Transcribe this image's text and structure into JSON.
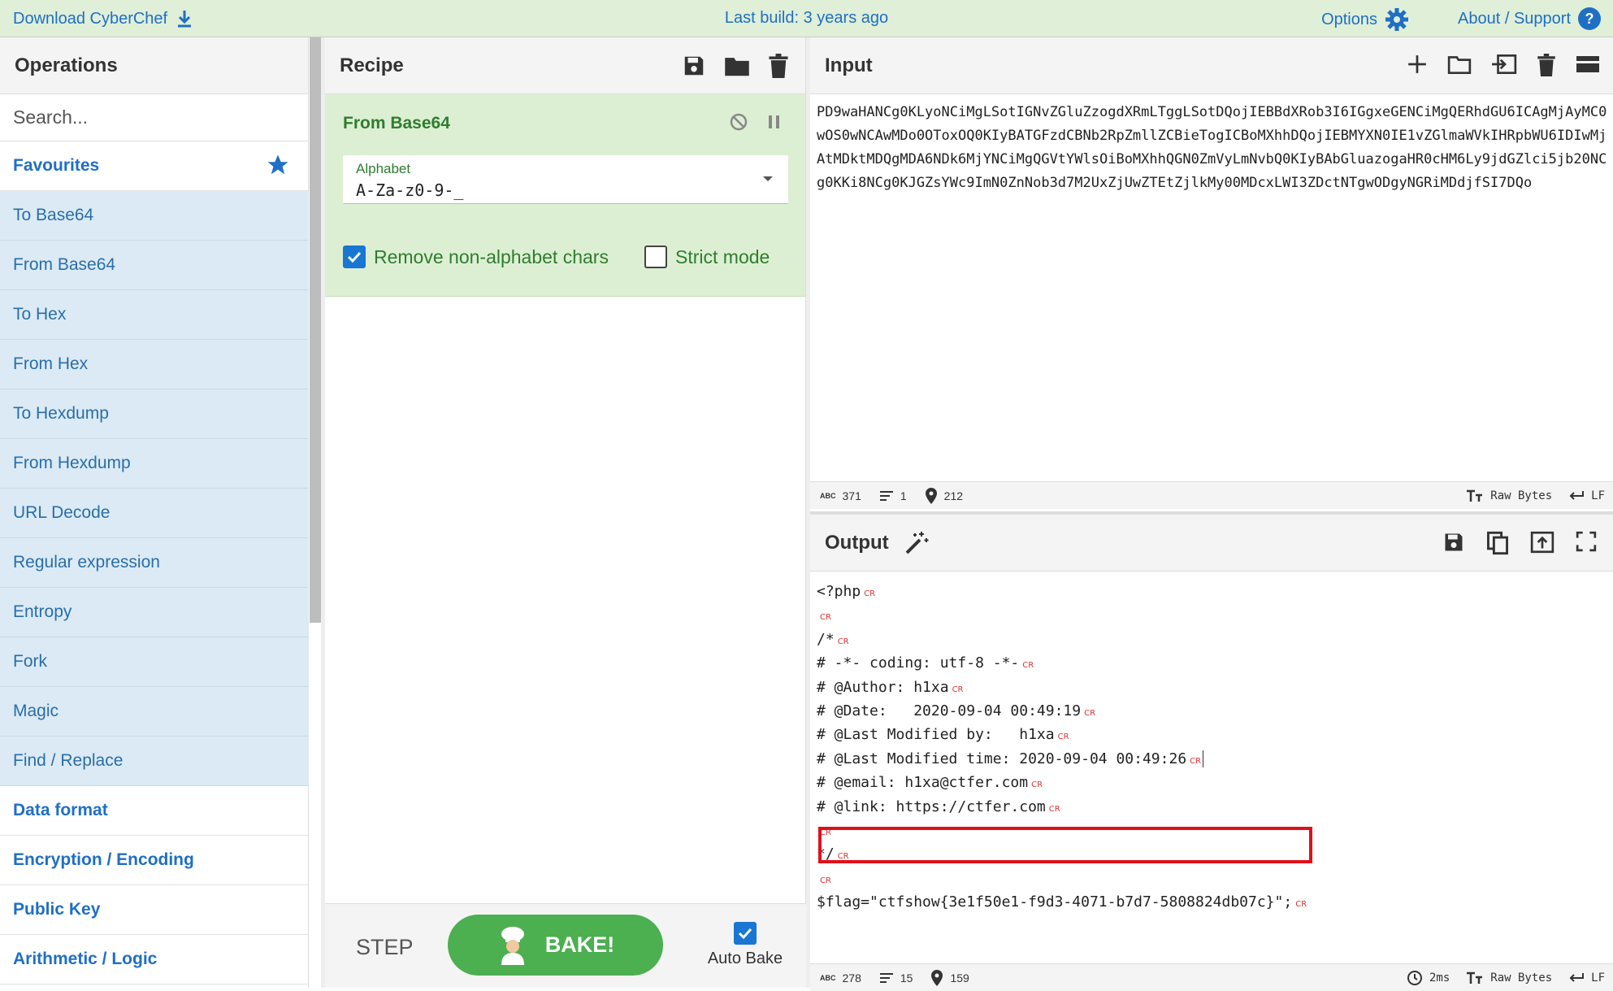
{
  "banner": {
    "download_label": "Download CyberChef",
    "last_build": "Last build: 3 years ago",
    "options_label": "Options",
    "about_label": "About / Support",
    "accent": "#1f6fc5"
  },
  "operations": {
    "title": "Operations",
    "search_placeholder": "Search...",
    "favourites_label": "Favourites",
    "items": [
      "To Base64",
      "From Base64",
      "To Hex",
      "From Hex",
      "To Hexdump",
      "From Hexdump",
      "URL Decode",
      "Regular expression",
      "Entropy",
      "Fork",
      "Magic",
      "Find / Replace"
    ],
    "categories": [
      "Data format",
      "Encryption / Encoding",
      "Public Key",
      "Arithmetic / Logic"
    ]
  },
  "recipe": {
    "title": "Recipe",
    "operation_name": "From Base64",
    "alphabet_label": "Alphabet",
    "alphabet_value": "A-Za-z0-9-_",
    "remove_nonalpha_label": "Remove non-alphabet chars",
    "remove_nonalpha_checked": true,
    "strict_mode_label": "Strict mode",
    "strict_mode_checked": false,
    "step_label": "STEP",
    "bake_label": "BAKE!",
    "auto_bake_label": "Auto Bake",
    "auto_bake_checked": true
  },
  "input": {
    "title": "Input",
    "text": "PD9waHANCg0KLyoNCiMgLSotIGNvZGluZzogdXRmLTggLSotDQojIEBBdXRob3I6IGgxeGENCiMgQERhdGU6ICAgMjAyMC0wOS0wNCAwMDo0OToxOQ0KIyBATGFzdCBNb2RpZmllZCBieTogICBoMXhhDQojIEBMYXN0IE1vZGlmaWVkIHRpbWU6IDIwMjAtMDktMDQgMDA6NDk6MjYNCiMgQGVtYWlsOiBoMXhhQGN0ZmVyLmNvbQ0KIyBAbGluazogaHR0cHM6Ly9jdGZlci5jb20NCg0KKi8NCg0KJGZsYWc9ImN0ZnNob3d7M2UxZjUwZTEtZjlkMy00MDcxLWI3ZDctNTgwODgyNGRiMDdjfSI7DQo",
    "stats": {
      "length": "371",
      "lines": "1",
      "position": "212",
      "encoding": "Raw Bytes",
      "eol": "LF"
    }
  },
  "output": {
    "title": "Output",
    "lines": [
      "<?php",
      "",
      "/*",
      "# -*- coding: utf-8 -*-",
      "# @Author: h1xa",
      "# @Date:   2020-09-04 00:49:19",
      "# @Last Modified by:   h1xa",
      "# @Last Modified time: 2020-09-04 00:49:26",
      "# @email: h1xa@ctfer.com",
      "# @link: https://ctfer.com",
      "",
      "*/",
      "",
      "$flag=\"ctfshow{3e1f50e1-f9d3-4071-b7d7-5808824db07c}\";"
    ],
    "cr_marker": "CR",
    "stats": {
      "length": "278",
      "lines": "15",
      "position": "159",
      "time": "2ms",
      "encoding": "Raw Bytes",
      "eol": "LF"
    },
    "highlight_color": "#e0101a"
  }
}
